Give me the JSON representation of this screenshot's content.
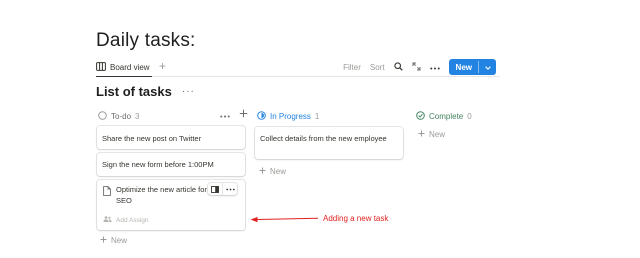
{
  "page": {
    "title": "Daily tasks:"
  },
  "toolbar": {
    "view_tab": "Board view",
    "add_view": "+",
    "filter": "Filter",
    "sort": "Sort",
    "new_button": "New"
  },
  "board": {
    "title": "List of tasks",
    "menu": "···",
    "columns": [
      {
        "label": "To-do",
        "count": "3",
        "add_new": "New"
      },
      {
        "label": "In Progress",
        "count": "1",
        "add_new": "New"
      },
      {
        "label": "Complete",
        "count": "0",
        "add_new": "New"
      }
    ],
    "todo_cards": [
      {
        "text": "Share the new post on Twitter"
      },
      {
        "text": "Sign the new form before 1:00PM"
      },
      {
        "text": "Optimize the new article for better SEO",
        "assign": "Add Assign"
      }
    ],
    "progress_cards": [
      {
        "text": "Collect details from the new employee"
      }
    ]
  },
  "annotation": {
    "text": "Adding a new task",
    "color": "#e0211f"
  },
  "colors": {
    "accent": "#2383e2",
    "in_progress": "#2383e2",
    "complete": "#448361"
  }
}
